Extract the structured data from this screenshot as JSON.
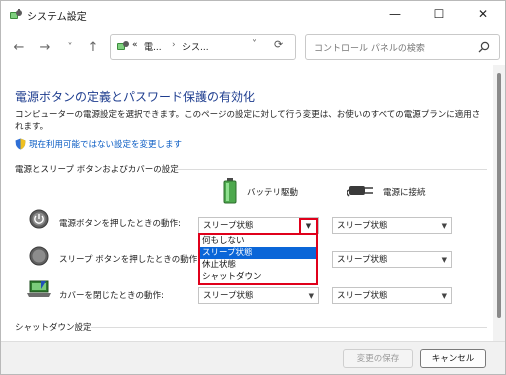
{
  "window": {
    "title": "システム設定"
  },
  "window_controls": {
    "minimize": "—",
    "maximize": "☐",
    "close": "✕"
  },
  "nav": {
    "back": "←",
    "forward": "→",
    "history": "˅",
    "up": "↑",
    "breadcrumb": [
      "«",
      "電...",
      "シス..."
    ],
    "breadcrumb_sep": "›",
    "dropdown": "˅",
    "refresh": "⟳"
  },
  "search": {
    "placeholder": "コントロール パネルの検索"
  },
  "page": {
    "heading": "電源ボタンの定義とパスワード保護の有効化",
    "description": "コンピューターの電源設定を選択できます。このページの設定に対して行う変更は、お使いのすべての電源プランに適用されます。",
    "admin_link": "現在利用可能ではない設定を変更します",
    "section_buttons": "電源とスリープ ボタンおよびカバーの設定",
    "section_shutdown": "シャットダウン設定"
  },
  "columns": {
    "battery": "バッテリ駆動",
    "plugged": "電源に接続"
  },
  "rows": [
    {
      "label": "電源ボタンを押したときの動作:",
      "battery": "スリープ状態",
      "plugged": "スリープ状態"
    },
    {
      "label": "スリープ ボタンを押したときの動作:",
      "battery": "スリープ状態",
      "plugged": "スリープ状態"
    },
    {
      "label": "カバーを閉じたときの動作:",
      "battery": "スリープ状態",
      "plugged": "スリープ状態"
    }
  ],
  "dropdown_options": [
    "何もしない",
    "スリープ状態",
    "休止状態",
    "シャットダウン"
  ],
  "dropdown_selected_index": 1,
  "footer": {
    "save": "変更の保存",
    "cancel": "キャンセル"
  },
  "colors": {
    "heading": "#1e3d8f",
    "link": "#0a5cc4",
    "highlight": "#0a66d8",
    "callout": "#e0001b"
  }
}
